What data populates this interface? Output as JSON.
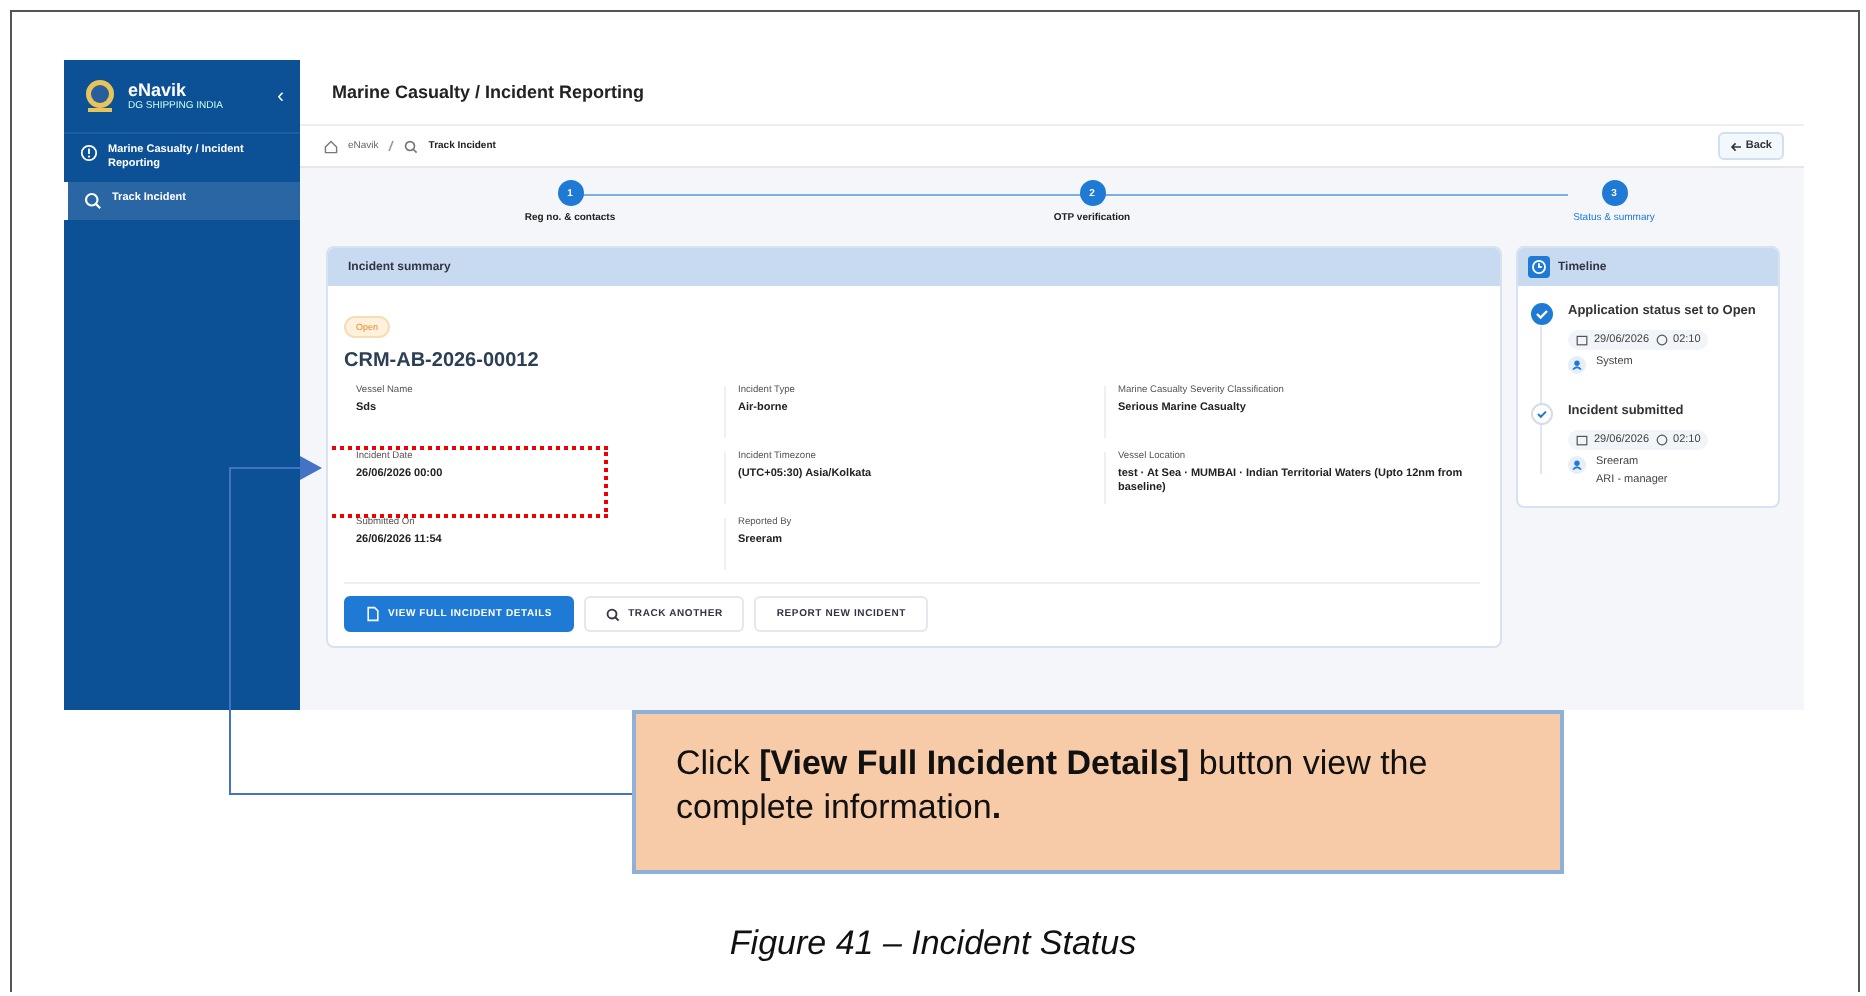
{
  "sidebar": {
    "brand": "eNavik",
    "subtitle": "DG SHIPPING INDIA",
    "collapse": "‹",
    "items": [
      {
        "label": "Marine Casualty / Incident Reporting",
        "selected": false
      },
      {
        "label": "Track Incident",
        "selected": true
      }
    ]
  },
  "header": {
    "title": "Marine Casualty / Incident Reporting"
  },
  "breadcrumb": [
    "eNavik",
    "Track Incident"
  ],
  "back": "Back",
  "steps": [
    {
      "number": "1",
      "label": "Reg no. & contacts",
      "selected": false
    },
    {
      "number": "2",
      "label": "OTP verification",
      "selected": false
    },
    {
      "number": "3",
      "label": "Status & summary",
      "selected": true
    }
  ],
  "summary": {
    "title": "Incident summary",
    "status": "Open",
    "reference": "CRM-AB-2026-00012",
    "fields": [
      {
        "label": "Vessel Name",
        "value": "Sds",
        "highlighted": false
      },
      {
        "label": "Incident Type",
        "value": "Air-borne",
        "highlighted": false
      },
      {
        "label": "Marine Casualty Severity Classification",
        "value": "Serious Marine Casualty",
        "highlighted": false
      },
      {
        "label": "Incident Date",
        "value": "26/06/2026 00:00",
        "highlighted": true
      },
      {
        "label": "Incident Timezone",
        "value": "(UTC+05:30) Asia/Kolkata",
        "highlighted": false
      },
      {
        "label": "Vessel Location",
        "value": "test · At Sea · MUMBAI · Indian Territorial Waters (Upto 12nm from baseline)",
        "highlighted": false
      },
      {
        "label": "Submitted On",
        "value": "26/06/2026 11:54",
        "highlighted": false
      },
      {
        "label": "Reported By",
        "value": "Sreeram",
        "highlighted": false
      }
    ],
    "actions": [
      {
        "label": "VIEW FULL INCIDENT DETAILS",
        "kind": "primary"
      },
      {
        "label": "TRACK ANOTHER",
        "kind": "search"
      },
      {
        "label": "REPORT NEW INCIDENT",
        "kind": "plain"
      }
    ]
  },
  "timeline": {
    "title": "Timeline",
    "events": [
      {
        "title": "Application status set to Open",
        "date": "29/06/2026",
        "time": "02:10",
        "by": [
          "System"
        ],
        "kind": "current"
      },
      {
        "title": "Incident submitted",
        "date": "29/06/2026",
        "time": "02:10",
        "by": [
          "Sreeram",
          "ARI  -  manager"
        ],
        "kind": "past"
      }
    ]
  },
  "callout": {
    "text": "Click **[View Full Incident Details]** button view the complete information**.**"
  },
  "caption": "Figure 41 – Incident Status"
}
